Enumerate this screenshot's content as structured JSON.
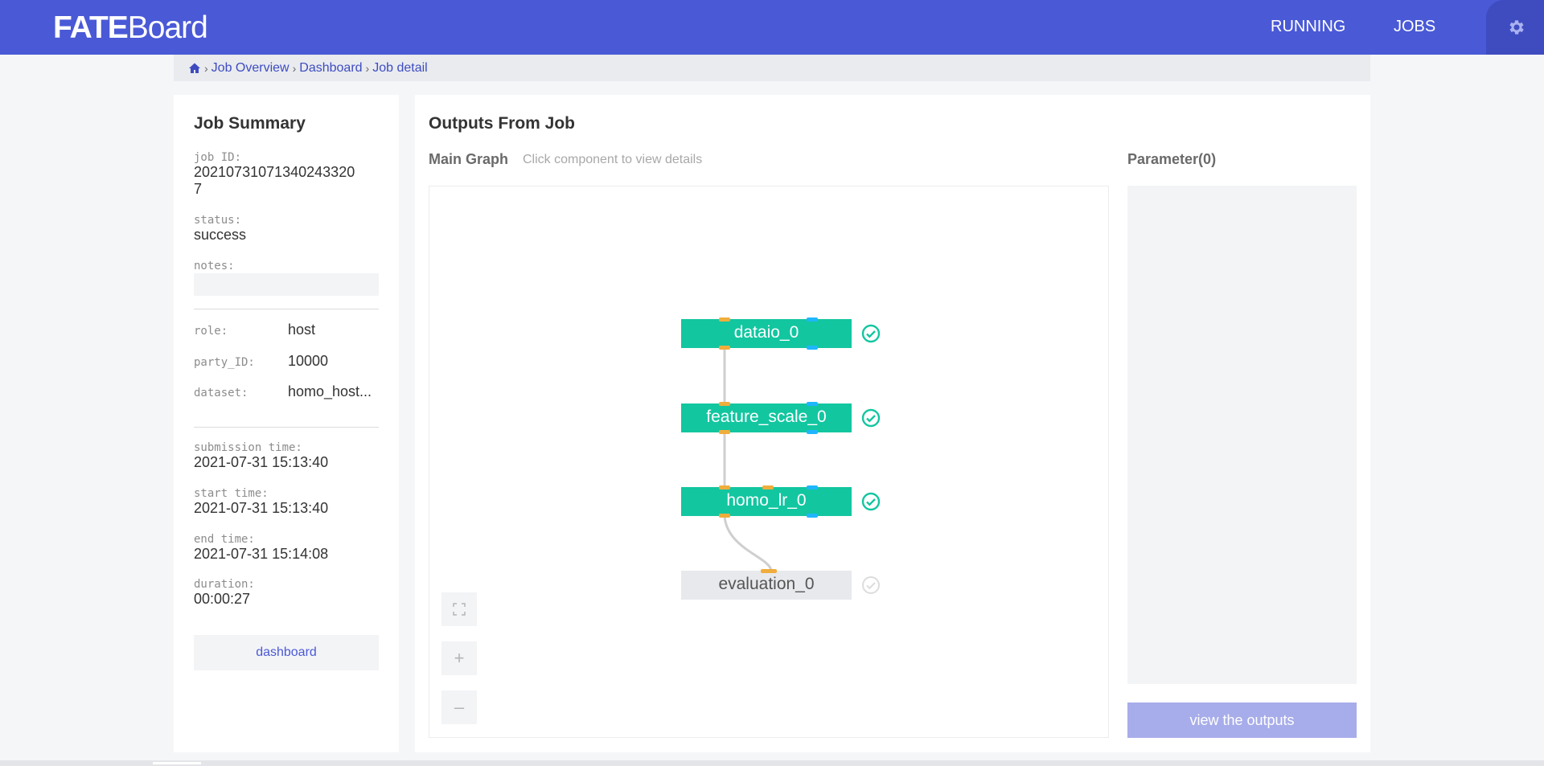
{
  "header": {
    "logo_bold": "FATE",
    "logo_rest": "Board",
    "nav": [
      {
        "label": "RUNNING"
      },
      {
        "label": "JOBS"
      }
    ],
    "brand_color": "#4a59d6"
  },
  "breadcrumb": {
    "items": [
      "Job Overview",
      "Dashboard",
      "Job detail"
    ]
  },
  "summary": {
    "title": "Job Summary",
    "job_id_label": "job ID:",
    "job_id_line1": "20210731071340243320",
    "job_id_line2": "7",
    "status_label": "status:",
    "status_value": "success",
    "notes_label": "notes:",
    "notes_value": "",
    "role_label": "role:",
    "role_value": "host",
    "party_label": "party_ID:",
    "party_value": "10000",
    "dataset_label": "dataset:",
    "dataset_value": "homo_host...",
    "submission_label": "submission time:",
    "submission_value": "2021-07-31 15:13:40",
    "start_label": "start time:",
    "start_value": "2021-07-31 15:13:40",
    "end_label": "end time:",
    "end_value": "2021-07-31 15:14:08",
    "duration_label": "duration:",
    "duration_value": "00:00:27",
    "dashboard_button": "dashboard"
  },
  "outputs": {
    "title": "Outputs From Job",
    "main_graph_label": "Main Graph",
    "hint": "Click component to view details",
    "parameter_label": "Parameter(0)",
    "view_button": "view the outputs",
    "nodes": [
      {
        "name": "dataio_0",
        "status": "success"
      },
      {
        "name": "feature_scale_0",
        "status": "success"
      },
      {
        "name": "homo_lr_0",
        "status": "success"
      },
      {
        "name": "evaluation_0",
        "status": "pending"
      }
    ],
    "controls": [
      "fullscreen-icon",
      "plus-icon",
      "minus-icon"
    ],
    "success_color": "#12c6a0"
  }
}
